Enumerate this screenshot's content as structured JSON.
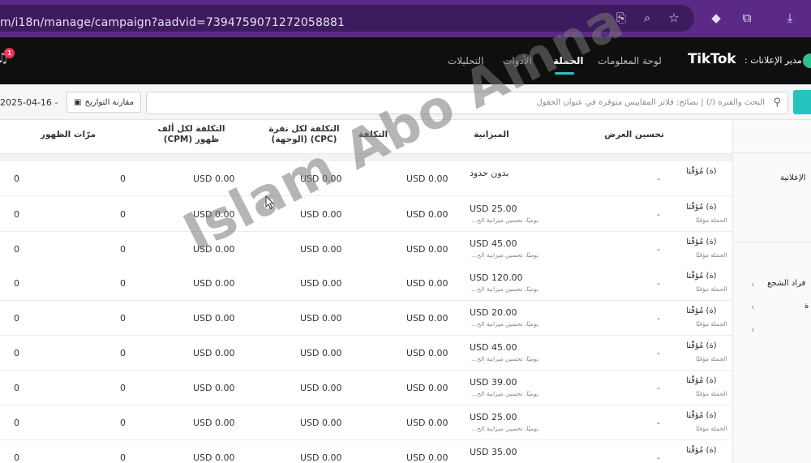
{
  "browser": {
    "url": "m/i18n/manage/campaign?aadvid=7394759071272058881",
    "icons": [
      "translate-icon",
      "zoom-icon",
      "star-icon",
      "extension-icon",
      "puzzle-icon",
      "download-icon"
    ]
  },
  "header": {
    "brand": "TikTok",
    "brand_sub": "مدير الإعلانات :",
    "nav": [
      "لوحة المعلومات",
      "الحملة",
      "الأدوات",
      "التحليلات"
    ],
    "active_nav": "الحملة",
    "notification_count": "1"
  },
  "toolbar": {
    "date_range": "2025-04-16 -",
    "compare_label": "مقارنة التواريخ",
    "search_placeholder": "البحث والفترة (/) | نصائح: فلاتر المقاييس متوفرة في عنوان الحقول"
  },
  "sidebar": {
    "title": "الإعلانية",
    "item": "فراد الشجع",
    "item2": "ة"
  },
  "table": {
    "columns": {
      "optimization": "تحسين العرض",
      "budget": "الميزانية",
      "cost": "التكلفة",
      "cpc": "التكلفة لكل نقرة (CPC) (الوجهة)",
      "cpm": "التكلفة لكل ألف ظهور (CPM)",
      "impressions": "مرّات الظهور"
    },
    "rows": [
      {
        "name": "(ة) مُؤقّتا",
        "name_sub": "",
        "opt": "-",
        "budget": "بدون حدود",
        "budget_sub": "",
        "cost": "USD 0.00",
        "cpc": "USD 0.00",
        "cpm": "USD 0.00",
        "col_a": "0",
        "col_b": "0"
      },
      {
        "name": "(ة) مُؤقّتا",
        "name_sub": "الحملة مؤقتًا",
        "opt": "-",
        "budget": "USD 25.00",
        "budget_sub": "يوميًا، تحسين ميزانية الح...",
        "cost": "USD 0.00",
        "cpc": "USD 0.00",
        "cpm": "USD 0.00",
        "col_a": "0",
        "col_b": "0"
      },
      {
        "name": "(ة) مُؤقّتا",
        "name_sub": "الحملة مؤقتًا",
        "opt": "-",
        "budget": "USD 45.00",
        "budget_sub": "يوميًا، تحسين ميزانية الح...",
        "cost": "USD 0.00",
        "cpc": "USD 0.00",
        "cpm": "USD 0.00",
        "col_a": "0",
        "col_b": "0"
      },
      {
        "name": "(ة) مُؤقّتا",
        "name_sub": "الحملة مؤقتًا",
        "opt": "-",
        "budget": "USD 120.00",
        "budget_sub": "يوميًا، تحسين ميزانية الح...",
        "cost": "USD 0.00",
        "cpc": "USD 0.00",
        "cpm": "USD 0.00",
        "col_a": "0",
        "col_b": "0"
      },
      {
        "name": "(ة) مُؤقّتا",
        "name_sub": "الحملة مؤقتًا",
        "opt": "-",
        "budget": "USD 20.00",
        "budget_sub": "يوميًا، تحسين ميزانية الح...",
        "cost": "USD 0.00",
        "cpc": "USD 0.00",
        "cpm": "USD 0.00",
        "col_a": "0",
        "col_b": "0"
      },
      {
        "name": "(ة) مُؤقّتا",
        "name_sub": "الحملة مؤقتًا",
        "opt": "-",
        "budget": "USD 45.00",
        "budget_sub": "يوميًا، تحسين ميزانية الح...",
        "cost": "USD 0.00",
        "cpc": "USD 0.00",
        "cpm": "USD 0.00",
        "col_a": "0",
        "col_b": "0"
      },
      {
        "name": "(ة) مُؤقّتا",
        "name_sub": "الحملة مؤقتًا",
        "opt": "-",
        "budget": "USD 39.00",
        "budget_sub": "يوميًا، تحسين ميزانية الح...",
        "cost": "USD 0.00",
        "cpc": "USD 0.00",
        "cpm": "USD 0.00",
        "col_a": "0",
        "col_b": "0"
      },
      {
        "name": "(ة) مُؤقّتا",
        "name_sub": "الحملة مؤقتًا",
        "opt": "-",
        "budget": "USD 25.00",
        "budget_sub": "يوميًا، تحسين ميزانية الح...",
        "cost": "USD 0.00",
        "cpc": "USD 0.00",
        "cpm": "USD 0.00",
        "col_a": "0",
        "col_b": "0"
      },
      {
        "name": "(ة) مُؤقّتا",
        "name_sub": "",
        "opt": "-",
        "budget": "USD 35.00",
        "budget_sub": "",
        "cost": "USD 0.00",
        "cpc": "USD 0.00",
        "cpm": "USD 0.00",
        "col_a": "0",
        "col_b": "0"
      }
    ]
  },
  "watermark": "Islam Abo Amna",
  "colors": {
    "browser_bar": "#5b2a86",
    "header_bg": "#0f0f10",
    "accent": "#25c4bf",
    "badge": "#fe2c55"
  }
}
